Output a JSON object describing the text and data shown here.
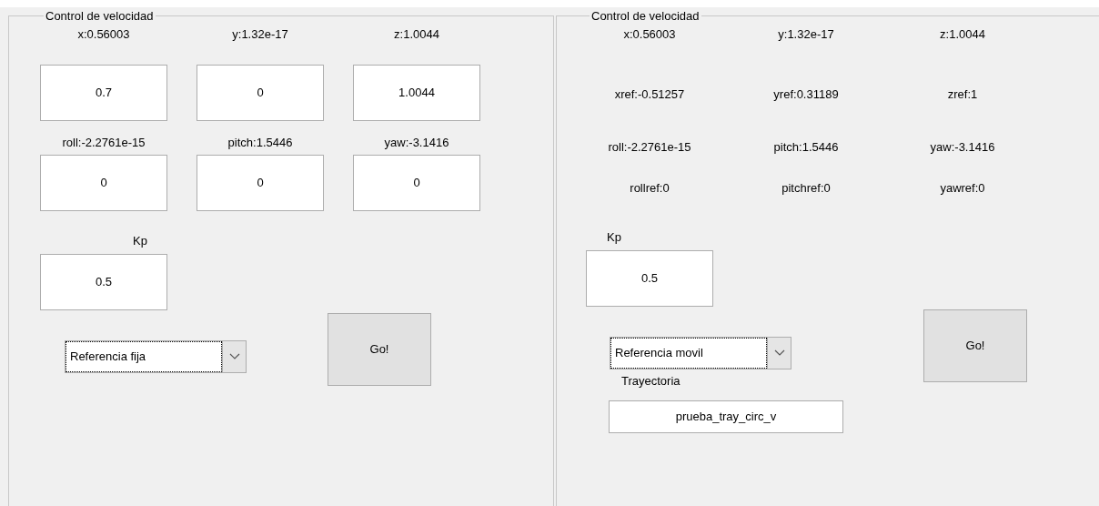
{
  "panels": [
    {
      "kind": "setpoint",
      "title": "Control de velocidad",
      "groups": [
        {
          "labels": [
            "x:0.56003",
            "y:1.32e-17",
            "z:1.0044"
          ],
          "values": [
            "0.7",
            "0",
            "1.0044"
          ]
        },
        {
          "labels": [
            "roll:-2.2761e-15",
            "pitch:1.5446",
            "yaw:-3.1416"
          ],
          "values": [
            "0",
            "0",
            "0"
          ]
        }
      ],
      "kp": {
        "label": "Kp",
        "value": "0.5"
      },
      "mode": {
        "value": "Referencia fija",
        "focused": true
      },
      "go": "Go!"
    },
    {
      "kind": "tracking",
      "title": "Control de velocidad",
      "readout_rows": [
        [
          "x:0.56003",
          "y:1.32e-17",
          "z:1.0044"
        ],
        [
          "xref:-0.51257",
          "yref:0.31189",
          "zref:1"
        ],
        [
          "roll:-2.2761e-15",
          "pitch:1.5446",
          "yaw:-3.1416"
        ],
        [
          "rollref:0",
          "pitchref:0",
          "yawref:0"
        ]
      ],
      "kp": {
        "label": "Kp",
        "value": "0.5"
      },
      "mode": {
        "value": "Referencia movil",
        "focused": true
      },
      "go": "Go!",
      "trajectory": {
        "label": "Trayectoria",
        "value": "prueba_tray_circ_v"
      }
    }
  ]
}
